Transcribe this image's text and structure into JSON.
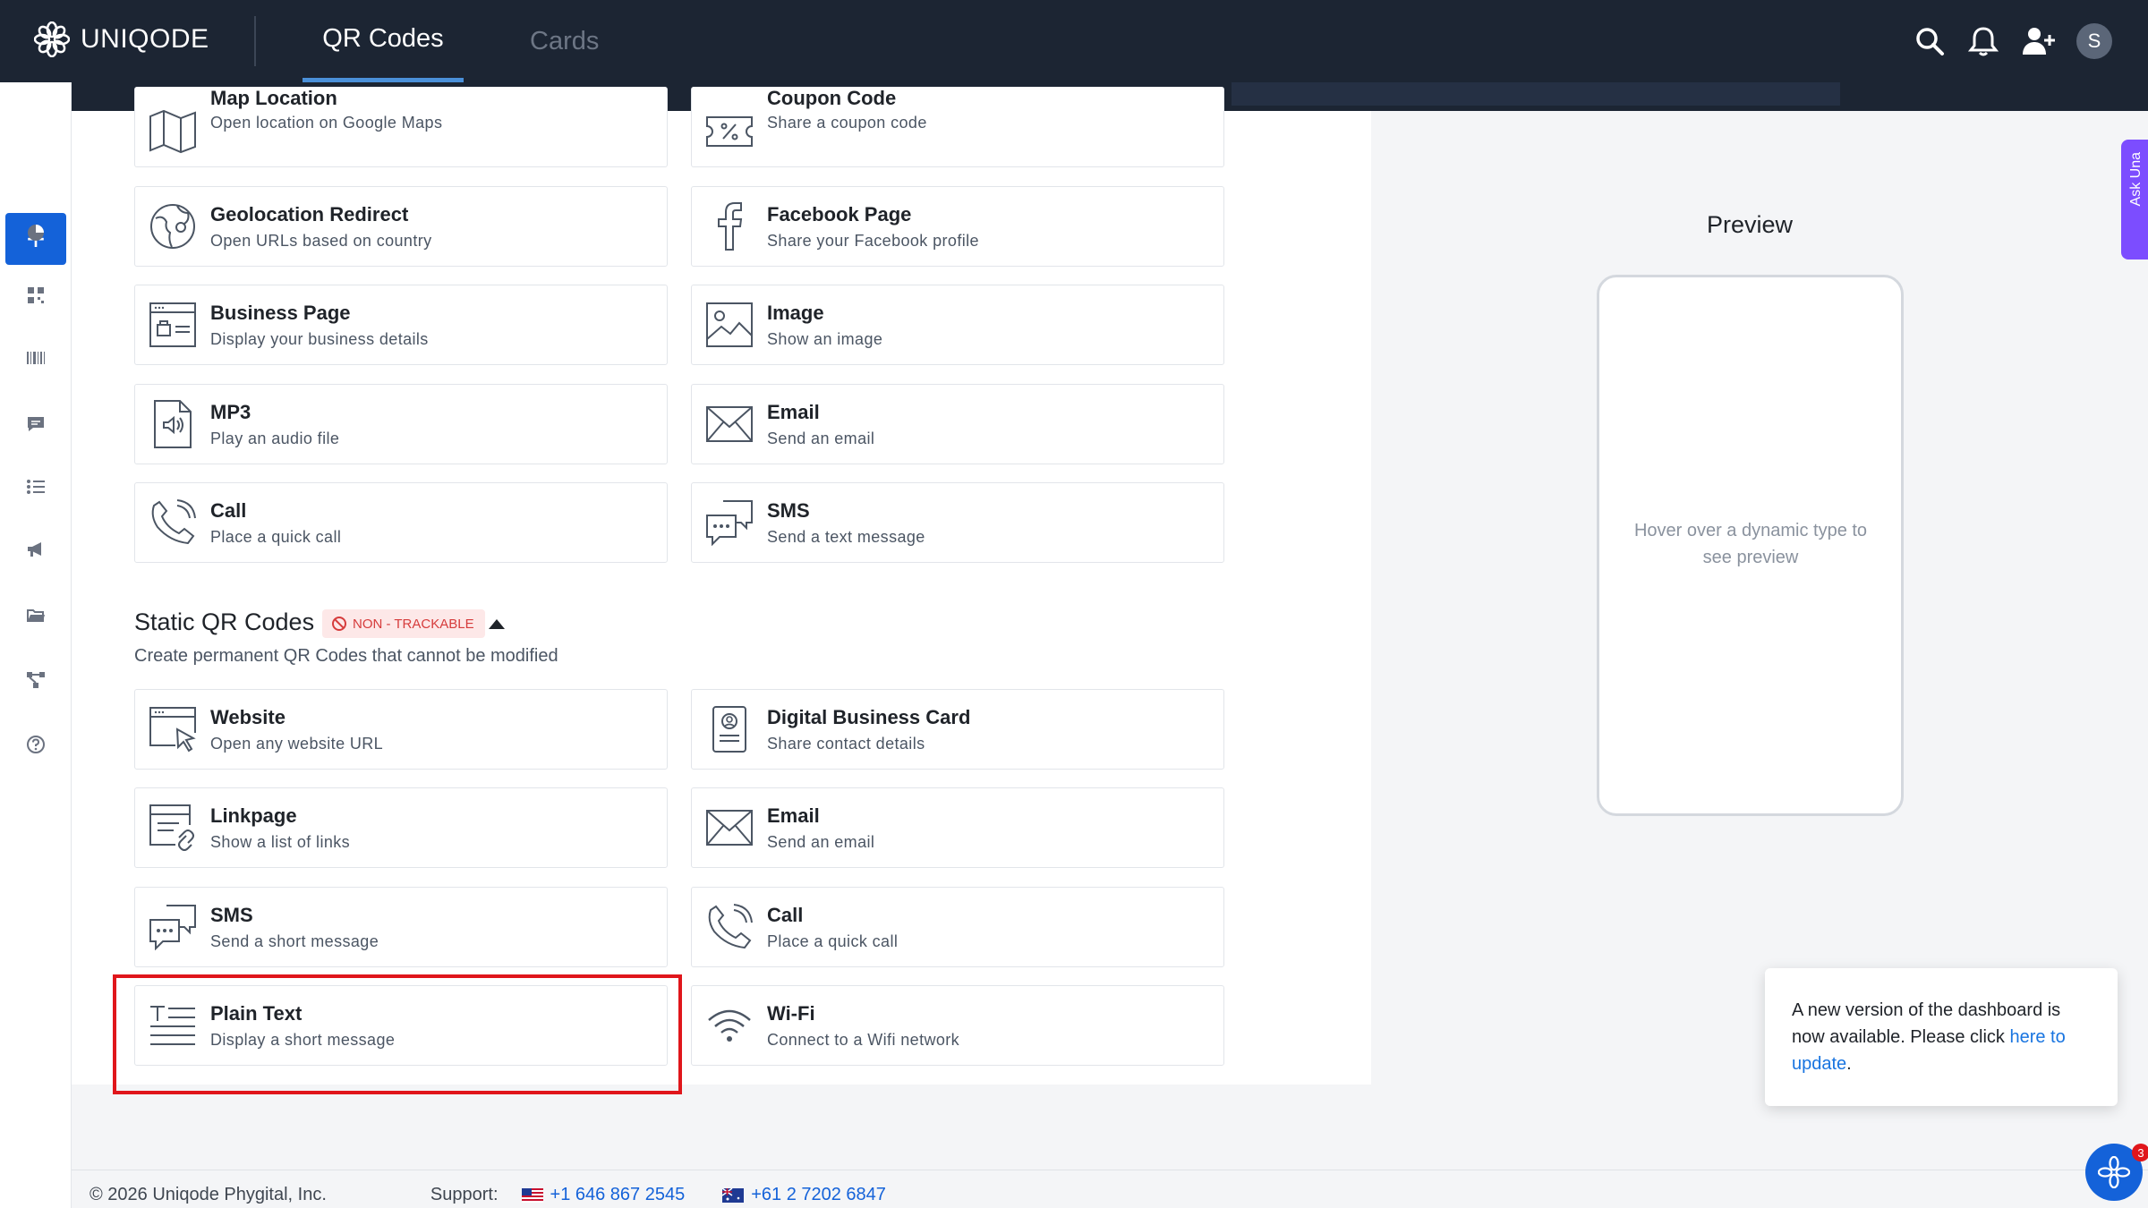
{
  "topbar": {
    "brand": "UNIQODE",
    "tabs": [
      {
        "label": "QR Codes",
        "active": true
      },
      {
        "label": "Cards",
        "active": false
      }
    ],
    "avatar_initial": "S"
  },
  "dynamic_cards": [
    {
      "title": "Map Location",
      "subtitle": "Open location on Google Maps",
      "icon": "map-icon"
    },
    {
      "title": "Coupon Code",
      "subtitle": "Share a coupon code",
      "icon": "coupon-icon"
    },
    {
      "title": "Geolocation Redirect",
      "subtitle": "Open URLs based on country",
      "icon": "globe-pin-icon"
    },
    {
      "title": "Facebook Page",
      "subtitle": "Share your Facebook profile",
      "icon": "facebook-icon"
    },
    {
      "title": "Business Page",
      "subtitle": "Display your business details",
      "icon": "business-page-icon"
    },
    {
      "title": "Image",
      "subtitle": "Show an image",
      "icon": "image-icon"
    },
    {
      "title": "MP3",
      "subtitle": "Play an audio file",
      "icon": "audio-file-icon"
    },
    {
      "title": "Email",
      "subtitle": "Send an email",
      "icon": "envelope-icon"
    },
    {
      "title": "Call",
      "subtitle": "Place a quick call",
      "icon": "phone-icon"
    },
    {
      "title": "SMS",
      "subtitle": "Send a text message",
      "icon": "sms-icon"
    }
  ],
  "static_section": {
    "title": "Static QR Codes",
    "badge": "NON - TRACKABLE",
    "subtitle": "Create permanent QR Codes that cannot be modified"
  },
  "static_cards": [
    {
      "title": "Website",
      "subtitle": "Open any website URL",
      "icon": "website-icon"
    },
    {
      "title": "Digital Business Card",
      "subtitle": "Share contact details",
      "icon": "contact-card-icon"
    },
    {
      "title": "Linkpage",
      "subtitle": "Show a list of links",
      "icon": "linkpage-icon"
    },
    {
      "title": "Email",
      "subtitle": "Send an email",
      "icon": "envelope-icon"
    },
    {
      "title": "SMS",
      "subtitle": "Send a short message",
      "icon": "sms-icon"
    },
    {
      "title": "Call",
      "subtitle": "Place a quick call",
      "icon": "phone-icon"
    },
    {
      "title": "Plain Text",
      "subtitle": "Display a short message",
      "icon": "plain-text-icon"
    },
    {
      "title": "Wi-Fi",
      "subtitle": "Connect to a Wifi network",
      "icon": "wifi-icon"
    }
  ],
  "preview": {
    "title": "Preview",
    "hint": "Hover over a dynamic type to see preview"
  },
  "ask_tab": {
    "label": "Ask Una"
  },
  "toast": {
    "text": "A new version of the dashboard is now available. Please click ",
    "link": "here to update",
    "end": "."
  },
  "footer": {
    "copyright": "© 2026 Uniqode Phygital, Inc.",
    "support_label": "Support:",
    "phone_us": "+1 646 867 2545",
    "phone_au": "+61 2 7202 6847"
  },
  "chat": {
    "badge_count": "3"
  },
  "colors": {
    "topbar": "#1c2533",
    "accent": "#1462d9",
    "highlight": "#e0161b",
    "badge_bg": "#fde8e8",
    "badge_text": "#d63c3c"
  }
}
